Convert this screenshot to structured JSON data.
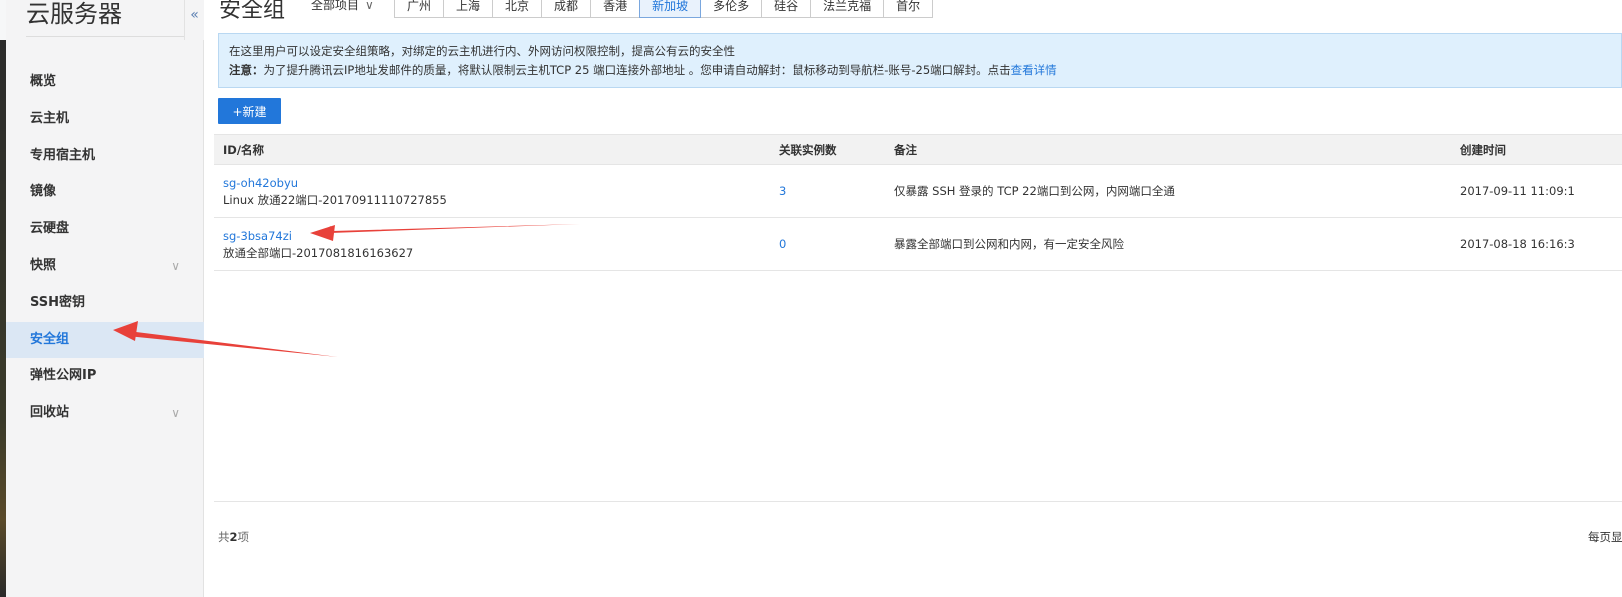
{
  "sidebar": {
    "title": "云服务器",
    "items": [
      {
        "label": "概览"
      },
      {
        "label": "云主机"
      },
      {
        "label": "专用宿主机"
      },
      {
        "label": "镜像"
      },
      {
        "label": "云硬盘"
      },
      {
        "label": "快照",
        "chevron": "chevron-down-icon"
      },
      {
        "label": "SSH密钥"
      },
      {
        "label": "安全组",
        "active": true
      },
      {
        "label": "弹性公网IP"
      },
      {
        "label": "回收站",
        "chevron": "chevron-down-icon"
      }
    ]
  },
  "header": {
    "title": "安全组",
    "project_label": "全部项目",
    "regions": [
      "广州",
      "上海",
      "北京",
      "成都",
      "香港",
      "新加坡",
      "多伦多",
      "硅谷",
      "法兰克福",
      "首尔"
    ],
    "active_region": "新加坡"
  },
  "notice": {
    "line1": "在这里用户可以设定安全组策略，对绑定的云主机进行内、外网访问权限控制，提高公有云的安全性",
    "line2_label": "注意：",
    "line2_text": "为了提升腾讯云IP地址发邮件的质量，将默认限制云主机TCP 25 端口连接外部地址 。您申请自动解封：鼠标移动到导航栏-账号-25端口解封。点击",
    "line2_link": "查看详情"
  },
  "toolbar": {
    "new_label": "+新建"
  },
  "table": {
    "columns": [
      "ID/名称",
      "关联实例数",
      "备注",
      "创建时间"
    ],
    "rows": [
      {
        "id": "sg-oh42obyu",
        "name": "Linux 放通22端口-20170911110727855",
        "count": "3",
        "remark": "仅暴露 SSH 登录的 TCP 22端口到公网，内网端口全通",
        "created": "2017-09-11 11:09:1"
      },
      {
        "id": "sg-3bsa74zi",
        "name": "放通全部端口-2017081816163627",
        "count": "0",
        "remark": "暴露全部端口到公网和内网，有一定安全风险",
        "created": "2017-08-18 16:16:3"
      }
    ]
  },
  "footer": {
    "total_prefix": "共",
    "total_count": "2",
    "total_suffix": "项",
    "per_page": "每页显"
  },
  "colors": {
    "accent": "#2277da",
    "notice_bg": "#dff0fd",
    "annotation": "#e8413a"
  }
}
